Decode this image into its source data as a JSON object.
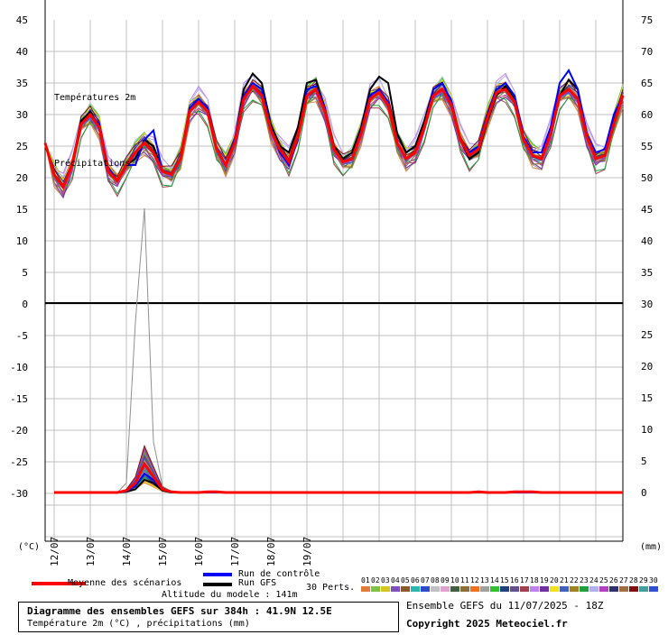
{
  "chart_data": {
    "type": "line",
    "title": "Diagramme des ensembles GEFS sur 384h : 41.9N 12.5E",
    "subtitle": "Température 2m (°C) , précipitations (mm)",
    "altitude": "Altitude du modele : 141m",
    "run_info": "Ensemble GEFS du 11/07/2025 - 18Z",
    "copyright": "Copyright 2025 Meteociel.fr",
    "label_temp": "Températures 2m",
    "label_precip": "Précipitations",
    "unit_left": "(°C)",
    "unit_right": "(mm)",
    "left_ticks": [
      "45",
      "40",
      "35",
      "30",
      "25",
      "20",
      "15",
      "10",
      "5",
      "0",
      "-5",
      "-10",
      "-15",
      "-20",
      "-25",
      "-30"
    ],
    "right_ticks": [
      "75",
      "70",
      "65",
      "60",
      "55",
      "50",
      "45",
      "40",
      "35",
      "30",
      "25",
      "20",
      "15",
      "10",
      "5",
      "0"
    ],
    "x_labels": [
      "12/07",
      "13/07",
      "14/07",
      "15/07",
      "16/07",
      "17/07",
      "18/07",
      "19/07"
    ],
    "temperature": {
      "x_hours": [
        0,
        6,
        12,
        18,
        24,
        30,
        36,
        42,
        48,
        54,
        60,
        66,
        72,
        78,
        84,
        90,
        96,
        102,
        108,
        114,
        120,
        126,
        132,
        138,
        144,
        150,
        156,
        162,
        168,
        174,
        180,
        186,
        192,
        198,
        204,
        210,
        216,
        222,
        228,
        234,
        240,
        246,
        252,
        258,
        264,
        270,
        276,
        282,
        288,
        294,
        300,
        306,
        312,
        318,
        324,
        330,
        336,
        342,
        348,
        354,
        360,
        366,
        372,
        378,
        384
      ],
      "mean": [
        25.5,
        20.5,
        18.5,
        22,
        28.5,
        30,
        28,
        21,
        19.5,
        22,
        24,
        25.5,
        24,
        21,
        20.5,
        23,
        30.5,
        32,
        30.5,
        24.5,
        22,
        25.5,
        32.5,
        34.5,
        33,
        27.5,
        24.5,
        22.5,
        26.5,
        33,
        34,
        30.5,
        24.5,
        22.5,
        23,
        27,
        32.5,
        33.5,
        31.5,
        25.5,
        23,
        24,
        28,
        33,
        34,
        31.5,
        26,
        23.5,
        24.5,
        29.5,
        33.5,
        34,
        32,
        26,
        23.5,
        23,
        27,
        33,
        34,
        32.5,
        26.5,
        23,
        23.5,
        28.5,
        33
      ],
      "control": [
        25.5,
        20.5,
        18.5,
        22,
        28.5,
        30,
        28.5,
        21.5,
        19.5,
        22,
        22,
        26,
        27.5,
        21,
        20.5,
        23,
        31,
        32.5,
        31,
        24.5,
        22,
        26,
        33,
        35,
        34,
        28,
        24,
        22,
        26,
        34,
        34.5,
        31,
        24.5,
        22.5,
        23,
        27.5,
        33,
        34,
        32,
        25.5,
        23,
        24,
        28,
        34,
        35,
        32,
        26,
        24,
        25,
        30,
        34,
        35,
        33,
        26.5,
        24,
        24,
        28,
        35,
        37,
        34,
        27,
        24,
        24.5,
        30,
        33
      ],
      "gfs": [
        25.5,
        20.5,
        18.5,
        22,
        29,
        30.5,
        28,
        21,
        19.5,
        22,
        23,
        26,
        25,
        21,
        20.5,
        23,
        31,
        32.5,
        31,
        24.5,
        22,
        26,
        34,
        36.5,
        35,
        28.5,
        25,
        24,
        28,
        35,
        35.5,
        31,
        25,
        23,
        24,
        28,
        34,
        36,
        35,
        27,
        24,
        25,
        29,
        34,
        35,
        32,
        26,
        23,
        24,
        29,
        33,
        34.5,
        32.5,
        26,
        23.5,
        23,
        27,
        33,
        35.5,
        34,
        27,
        23,
        23.5,
        29,
        33
      ],
      "member_offsets": [
        -2.0,
        -1.5,
        -1.0,
        -0.5,
        0.5,
        1.0,
        1.5,
        2.0,
        -1.2,
        -0.8,
        0.8,
        1.2,
        -1.8,
        1.8,
        -0.3,
        0.3,
        -2.5,
        2.5,
        -1.6,
        1.6,
        -0.6,
        0.6,
        -2.2,
        2.2,
        -1.0,
        1.0,
        -1.4,
        1.4,
        -0.2,
        0.2
      ]
    },
    "precipitation": {
      "x_hours": [
        6,
        12,
        18,
        24,
        30,
        36,
        42,
        48,
        54,
        60,
        66,
        72,
        78,
        84,
        90,
        96,
        102,
        108,
        114,
        120,
        126,
        132,
        138,
        144,
        150,
        156,
        162,
        168,
        174,
        180,
        186,
        192,
        198,
        204,
        210,
        216,
        222,
        228,
        234,
        240,
        246,
        252,
        258,
        264,
        270,
        276,
        282,
        288,
        294,
        300,
        306,
        312,
        318,
        324,
        330,
        336,
        342,
        348,
        354,
        360,
        366,
        372,
        378,
        384
      ],
      "mean": [
        0,
        0,
        0,
        0,
        0,
        0,
        0,
        0,
        0.3,
        1.5,
        4.5,
        2.5,
        0.5,
        0.1,
        0,
        0,
        0,
        0.1,
        0.1,
        0,
        0,
        0,
        0,
        0,
        0,
        0,
        0,
        0,
        0,
        0,
        0,
        0,
        0,
        0,
        0,
        0,
        0,
        0,
        0,
        0,
        0,
        0,
        0,
        0,
        0,
        0,
        0,
        0.1,
        0,
        0,
        0,
        0.1,
        0.1,
        0.1,
        0,
        0,
        0,
        0,
        0,
        0,
        0,
        0,
        0,
        0
      ],
      "control": [
        0,
        0,
        0,
        0,
        0,
        0,
        0,
        0,
        0.2,
        1,
        3,
        2,
        0.5,
        0,
        0,
        0,
        0,
        0,
        0,
        0,
        0,
        0,
        0,
        0,
        0,
        0,
        0,
        0,
        0,
        0,
        0,
        0,
        0,
        0,
        0,
        0,
        0,
        0,
        0,
        0,
        0,
        0,
        0,
        0,
        0,
        0,
        0,
        0,
        0,
        0,
        0,
        0,
        0,
        0,
        0,
        0,
        0,
        0,
        0,
        0,
        0,
        0,
        0,
        0
      ],
      "gfs": [
        0,
        0,
        0,
        0,
        0,
        0,
        0,
        0,
        0.1,
        0.5,
        2,
        1.5,
        0.3,
        0,
        0,
        0,
        0,
        0,
        0,
        0,
        0,
        0,
        0,
        0,
        0,
        0,
        0,
        0,
        0,
        0,
        0,
        0,
        0,
        0,
        0,
        0,
        0,
        0,
        0,
        0,
        0,
        0,
        0,
        0,
        0,
        0,
        0,
        0,
        0,
        0,
        0,
        0,
        0,
        0,
        0,
        0,
        0,
        0,
        0,
        0,
        0,
        0,
        0,
        0
      ],
      "max": [
        0,
        0,
        0,
        0,
        0,
        0,
        0,
        0,
        1.5,
        27,
        45,
        8,
        1,
        0.2,
        0,
        0,
        0,
        0.2,
        0.2,
        0,
        0,
        0,
        0,
        0,
        0,
        0,
        0,
        0,
        0,
        0,
        0,
        0,
        0,
        0,
        0,
        0,
        0,
        0,
        0,
        0,
        0,
        0,
        0,
        0,
        0,
        0,
        0,
        0.2,
        0,
        0,
        0,
        0.2,
        0.2,
        0.2,
        0,
        0,
        0,
        0,
        0,
        0,
        0,
        0,
        0,
        0
      ]
    },
    "legend": {
      "mean_label": "Moyenne des scénarios",
      "control_label": "Run de contrôle",
      "gfs_label": "Run GFS",
      "perts_label": "30 Perts.",
      "member_ids": [
        "01",
        "02",
        "03",
        "04",
        "05",
        "06",
        "07",
        "08",
        "09",
        "10",
        "11",
        "12",
        "13",
        "14",
        "15",
        "16",
        "17",
        "18",
        "19",
        "20",
        "21",
        "22",
        "23",
        "24",
        "25",
        "26",
        "27",
        "28",
        "29",
        "30"
      ]
    },
    "colors": {
      "mean": "#ff0000",
      "control": "#0000ff",
      "gfs": "#000000",
      "grid": "#c0c0c0",
      "members": [
        "#e07b39",
        "#7fc241",
        "#d6c61f",
        "#7f4fc0",
        "#8a5a2b",
        "#2bb5b0",
        "#2f4ac9",
        "#c0c0c0",
        "#e0a0d0",
        "#406040",
        "#8b6f3a",
        "#f07020",
        "#a0a0a0",
        "#30c030",
        "#204080",
        "#605090",
        "#a04050",
        "#c080f0",
        "#7030a0",
        "#f0e020",
        "#4060c0",
        "#a08020",
        "#20a040",
        "#b0b0f0",
        "#b040c0",
        "#303070",
        "#a07040",
        "#801010",
        "#40a0a0",
        "#3050d0"
      ]
    }
  }
}
